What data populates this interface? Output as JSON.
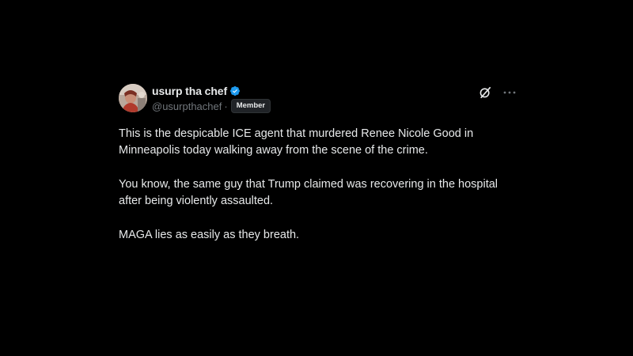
{
  "post": {
    "author": {
      "display_name": "usurp tha chef",
      "handle": "@usurpthachef",
      "separator": "·",
      "badge": "Member",
      "verified": true
    },
    "paragraphs": [
      "This is the despicable ICE agent that murdered Renee Nicole Good in Minneapolis today walking away from the scene of the crime.",
      "You know, the same guy that Trump claimed was recovering in the hospital after being violently assaulted.",
      "MAGA lies as easily as they breath."
    ],
    "icons": {
      "verified": "verified-badge-icon",
      "grok": "grok-icon",
      "more": "more-options-icon"
    }
  },
  "colors": {
    "background": "#000000",
    "text_primary": "#e7e9ea",
    "text_secondary": "#71767b",
    "verified_blue": "#1d9bf0"
  }
}
